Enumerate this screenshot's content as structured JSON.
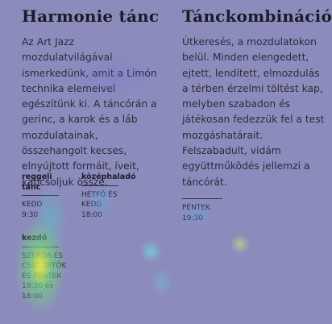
{
  "left": {
    "title": "Harmonie tánc",
    "paragraph": "Az Art Jazz mozdulatvilágával ismerkedünk, amit a Limón technika elemeivel egészítünk ki. A táncórán a gerinc, a karok és a láb mozdulatainak, összehangolt kecses, elnyújtott formáit, íveit, kapcsoljuk össze.",
    "schedules": [
      {
        "label_line1": "reggeli",
        "label_line2": "tánc",
        "days": "KEDD",
        "time": "9:30"
      },
      {
        "label_line1": "középhaladó",
        "days_line1": "HÉTFŐ ÉS",
        "days_line2": "KEDD",
        "time": "18:00"
      },
      {
        "label_line1": "kezdő",
        "days_line1": "SZERDA ÉS",
        "days_line2": "CSÜTÖRTÖK",
        "days_line3": "ÉS PÉNTEK",
        "time_line1": "19:30 és",
        "time_line2": "18:00"
      }
    ]
  },
  "right": {
    "title": "Tánckombinációk",
    "paragraph": "Útkeresés, a mozdulatokon belül. Minden elengedett, ejtett, lendített, elmozdulás a térben érzelmi töltést kap, melyben szabadon és játékosan fedezzük fel a test mozgáshatárait. Felszabadult, vidám együttműködés jellemzi a táncórát.",
    "schedule": {
      "days": "PÉNTEK",
      "time": "19:30"
    }
  }
}
